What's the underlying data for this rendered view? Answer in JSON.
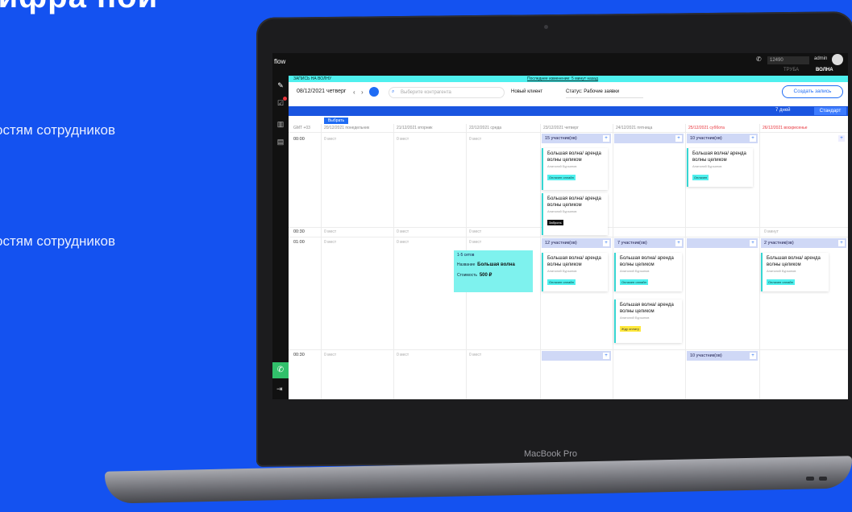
{
  "promo": {
    "heading": "цифра ной",
    "line1": "остям сотрудников",
    "frag1": ".",
    "line2": "остям сотрудников",
    "frag2": "."
  },
  "device": {
    "brand": "MacBook Pro"
  },
  "app": {
    "logo": "flow",
    "topbar": {
      "phone": "12490",
      "user": "admin",
      "tabs": [
        "ТРУБА",
        "ВОЛНА"
      ]
    },
    "header": {
      "title": "ЗАПИСЬ НА ВОЛНУ",
      "last_change": "Последнее изменение: 5 минут назад"
    },
    "controls": {
      "date": "08/12/2021 четверг",
      "search_placeholder": "Выберите контрагента",
      "new_client": "Новый клиент",
      "status": "Статус: Рабочие заявки",
      "create": "Создать запись"
    },
    "view": {
      "range": "7 дней",
      "mode": "Стандарт"
    },
    "grid": {
      "select": "Выбрать",
      "gmt": "GMT +03",
      "days": [
        "20/12/2021 понедельник",
        "21/12/2021 вторник",
        "22/12/2021 среда",
        "23/12/2021 четверг",
        "24/12/2021 пятница",
        "25/12/2021 суббота",
        "26/12/2021 воскресенье"
      ],
      "times": [
        "00:00",
        "00:30",
        "01:00",
        "00:30"
      ],
      "empty": "0 мест",
      "empty_min": "0 минут",
      "strips": {
        "d4_1": "15 участник(ов)",
        "d6_1": "10 участник(ов)",
        "d4_3": "12 участник(ов)",
        "d5_3": "7 участник(ов)",
        "d7_3": "2 участник(ов)",
        "d6_4": "10 участник(ов)"
      },
      "card_title": "Большая волна/ аренда волны целиком",
      "card_person": "Анатолий Бурьянов",
      "badges": {
        "paid": "Оплачен онлайн",
        "paid_short": "Оплачен",
        "booked": "Забронь",
        "wait": "Жду оплату"
      },
      "popup": {
        "caption": "1-5 сетов",
        "name_label": "Название",
        "name_value": "Большая волна",
        "price_label": "Стоимость",
        "price_value": "500 ₽"
      }
    }
  }
}
